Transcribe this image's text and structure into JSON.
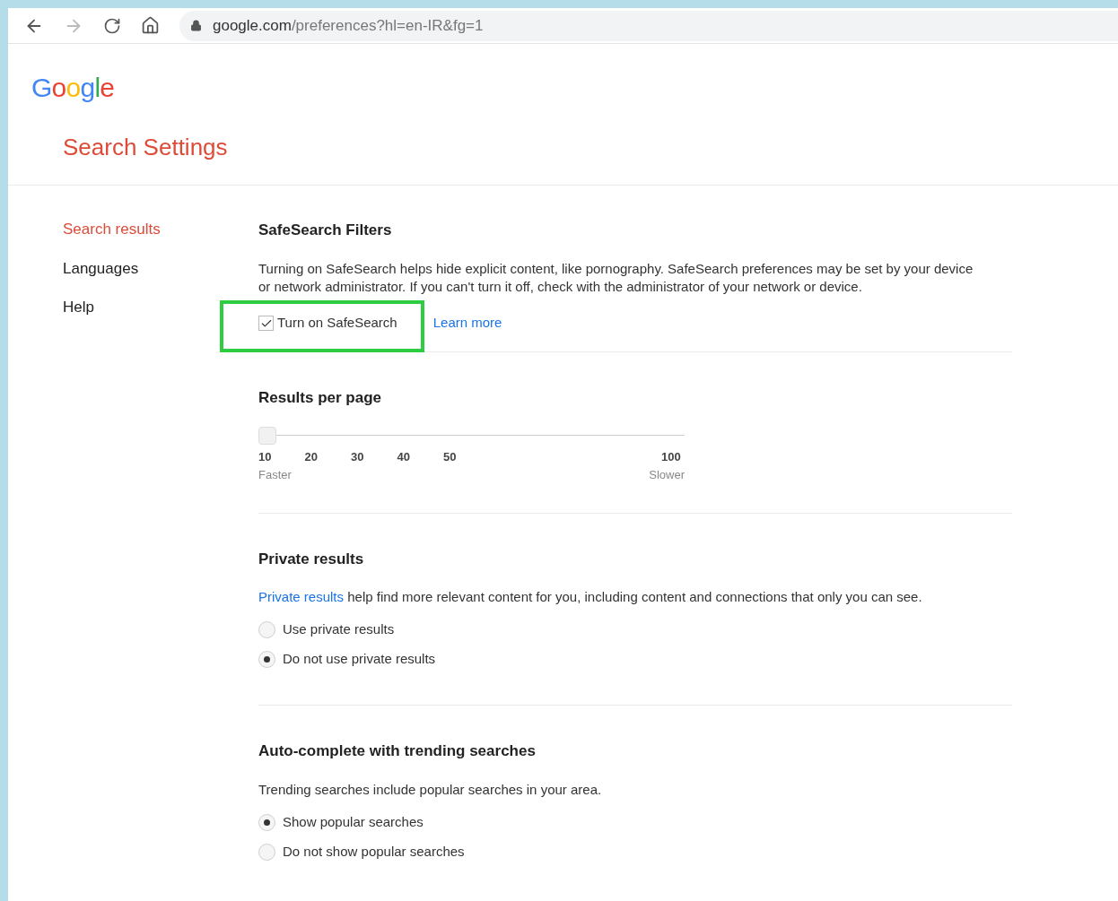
{
  "browser": {
    "url_host": "google.com",
    "url_path": "/preferences?hl=en-IR&fg=1"
  },
  "logo": "Google",
  "title": "Search Settings",
  "sidebar": {
    "items": [
      {
        "label": "Search results",
        "selected": true
      },
      {
        "label": "Languages",
        "selected": false
      },
      {
        "label": "Help",
        "selected": false
      }
    ]
  },
  "safesearch": {
    "heading": "SafeSearch Filters",
    "description": "Turning on SafeSearch helps hide explicit content, like pornography. SafeSearch preferences may be set by your device or network administrator. If you can't turn it off, check with the administrator of your network or device.",
    "checkbox": {
      "label": "Turn on SafeSearch",
      "checked": true,
      "highlighted": true
    },
    "link": "Learn more"
  },
  "results_per_page": {
    "heading": "Results per page",
    "level": 0,
    "ticks": [
      "10",
      "20",
      "30",
      "40",
      "50",
      "100"
    ],
    "left_caption": "Faster",
    "right_caption": "Slower"
  },
  "private_results": {
    "heading": "Private results",
    "link": "Private results",
    "description": " help find more relevant content for you, including content and connections that only you can see.",
    "options": [
      {
        "label": "Use private results",
        "selected": false
      },
      {
        "label": "Do not use private results",
        "selected": true
      }
    ]
  },
  "autocomplete": {
    "heading": "Auto-complete with trending searches",
    "description": "Trending searches include popular searches in your area.",
    "options": [
      {
        "label": "Show popular searches",
        "selected": true
      },
      {
        "label": "Do not show popular searches",
        "selected": false
      }
    ]
  }
}
